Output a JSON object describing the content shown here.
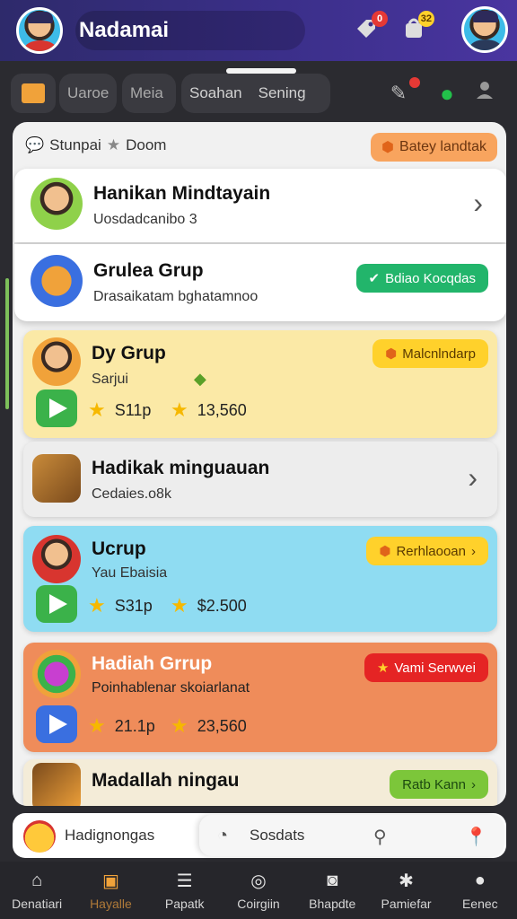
{
  "header": {
    "title": "Nadamai",
    "icons": [
      {
        "name": "tag-icon",
        "badge": "0"
      },
      {
        "name": "bag-icon",
        "badge": "32"
      }
    ]
  },
  "tabs": {
    "items": [
      "Uaroe",
      "Meia",
      "Soahan",
      "Sening"
    ]
  },
  "panel": {
    "heading": "Stunpai",
    "heading_extra": "Doom",
    "chip": "Batey landtak",
    "cards": [
      {
        "title": "Hanikan Mindtayain",
        "subtitle": "Uosdadcanibo 3"
      },
      {
        "title": "Grulea Grup",
        "subtitle": "Drasaikatam bghatamnoo",
        "button": "Bdiao Kocqdas"
      }
    ],
    "groups": [
      {
        "title": "Dy Grup",
        "subtitle": "Sarjui",
        "pill": "Malcnlndarp",
        "stat1": "S11p",
        "stat2": "13,560",
        "bg": "#fbe9a6",
        "pill_bg": "#ffd12b",
        "pill_color": "#5a3a00",
        "play_bg": "#3bb24a"
      },
      {
        "title": "Hadikak minguauan",
        "subtitle": "Cedaies.o8k"
      },
      {
        "title": "Ucrup",
        "subtitle": "Yau Ebaisia",
        "pill": "Rerhlaooan",
        "stat1": "S31p",
        "stat2": "$2.500",
        "bg": "#8fdcf2",
        "pill_bg": "#ffd12b",
        "pill_color": "#5a3a00",
        "play_bg": "#3bb24a"
      },
      {
        "title": "Hadiah Grrup",
        "subtitle": "Poinhablenar skoiarlanat",
        "pill": "Vami Serwvei",
        "stat1": "21.1p",
        "stat2": "23,560",
        "bg": "#ef8c5a",
        "pill_bg": "#e52424",
        "pill_color": "#ffffff",
        "play_bg": "#3a6fe0"
      },
      {
        "title": "Madallah ningau",
        "pill": "Ratb Kann"
      }
    ]
  },
  "search": {
    "left_label": "Hadignongas",
    "placeholder": "Sosdats"
  },
  "nav": [
    {
      "label": "Denatiari"
    },
    {
      "label": "Hayalle"
    },
    {
      "label": "Papatk"
    },
    {
      "label": "Coirgiin"
    },
    {
      "label": "Bhapdte"
    },
    {
      "label": "Pamiefar"
    },
    {
      "label": "Eenec"
    }
  ]
}
